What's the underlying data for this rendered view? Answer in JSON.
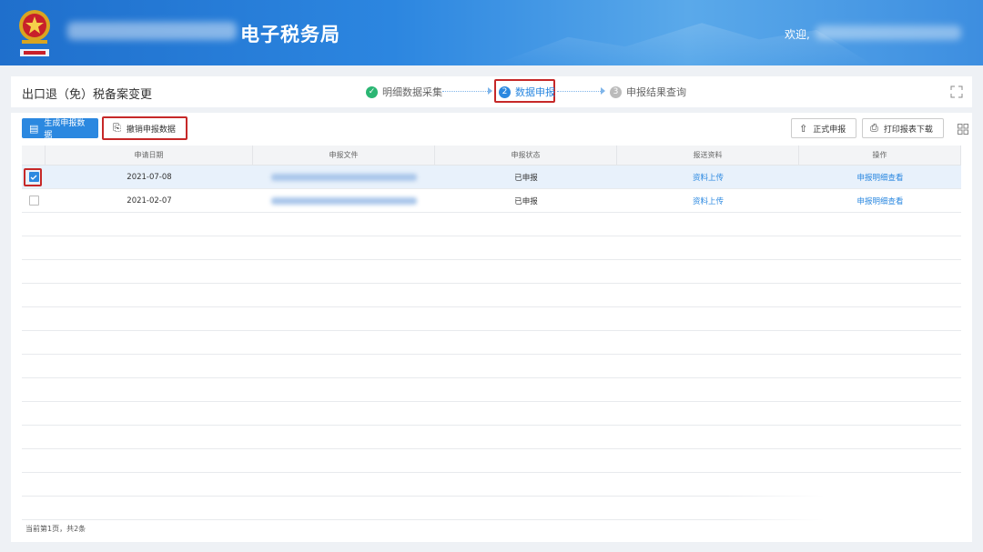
{
  "header": {
    "site_title": "电子税务局",
    "welcome": "欢迎,"
  },
  "stepbar": {
    "page_title": "出口退（免）税备案变更",
    "steps": [
      {
        "num": "✓",
        "label": "明细数据采集",
        "state": "done"
      },
      {
        "num": "2",
        "label": "数据申报",
        "state": "active"
      },
      {
        "num": "3",
        "label": "申报结果查询",
        "state": "pending"
      }
    ]
  },
  "toolbar": {
    "generate_label": "生成申报数据",
    "revoke_label": "撤销申报数据",
    "submit_label": "正式申报",
    "print_label": "打印报表下载"
  },
  "table": {
    "columns": [
      "申请日期",
      "申报文件",
      "申报状态",
      "报送资料",
      "操作"
    ],
    "rows": [
      {
        "checked": true,
        "date": "2021-07-08",
        "status": "已申报",
        "material": "资料上传",
        "op": "申报明细查看"
      },
      {
        "checked": false,
        "date": "2021-02-07",
        "status": "已申报",
        "material": "资料上传",
        "op": "申报明细查看"
      }
    ]
  },
  "pagination": {
    "text": "当前第1页，共2条"
  },
  "colors": {
    "accent": "#2b88e0",
    "done": "#2bb673",
    "highlight": "#c62828"
  }
}
